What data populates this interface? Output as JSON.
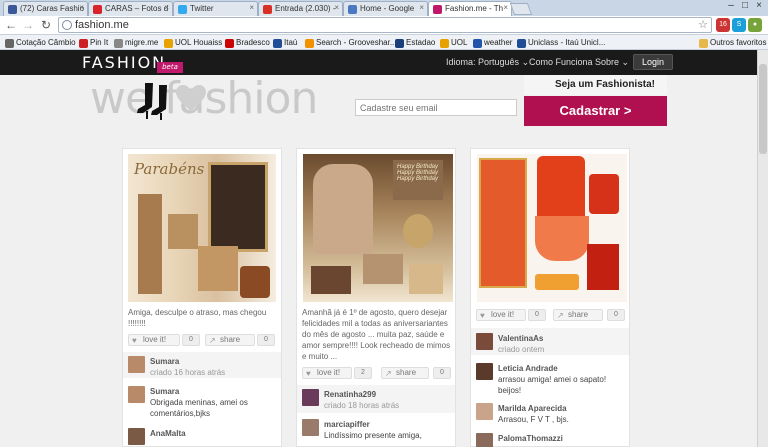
{
  "browser": {
    "tabs": [
      {
        "label": "(72) Caras Fashio",
        "color": "#3b5998"
      },
      {
        "label": "CARAS – Fotos d",
        "color": "#d8232a"
      },
      {
        "label": "Twitter",
        "color": "#33aaee"
      },
      {
        "label": "Entrada (2.030) -",
        "color": "#d93025"
      },
      {
        "label": "Home - Google",
        "color": "#4a78c2"
      },
      {
        "label": "Fashion.me - Th",
        "color": "#c0186a"
      }
    ],
    "url": "fashion.me",
    "bookmarks": [
      {
        "label": "Cotação Câmbio",
        "color": "#666"
      },
      {
        "label": "Pin It",
        "color": "#cc2127"
      },
      {
        "label": "migre.me",
        "color": "#888"
      },
      {
        "label": "UOL Houaiss",
        "color": "#e8a200"
      },
      {
        "label": "Bradesco",
        "color": "#cc0000"
      },
      {
        "label": "Itaú",
        "color": "#1f4e96"
      },
      {
        "label": "Search - Grooveshar...",
        "color": "#f39200"
      },
      {
        "label": "Estadao",
        "color": "#1a3e7a"
      },
      {
        "label": "UOL",
        "color": "#e8a200"
      },
      {
        "label": "weather",
        "color": "#2255aa"
      },
      {
        "label": "Uniclass - Itaú Unicl...",
        "color": "#1f4e96"
      },
      {
        "label": "Outros favoritos",
        "color": "#e6b84a"
      }
    ]
  },
  "site": {
    "logo": "FASHION",
    "beta": "beta",
    "nav": {
      "idioma": "Idioma: Português",
      "como": "Como Funciona",
      "sobre": "Sobre",
      "login": "Login"
    },
    "hero": {
      "text": "we fashion",
      "placeholder": "Cadastre seu email",
      "promo": "Seja um Fashionista!",
      "cta": "Cadastrar >"
    },
    "actions": {
      "love": "love it!",
      "share": "share"
    },
    "cards": [
      {
        "caption": "Amiga, desculpe o atraso, mas chegou !!!!!!!!",
        "love_count": "0",
        "share_count": "0",
        "comments": [
          {
            "user": "Sumara",
            "text": "criado 16 horas atrás"
          },
          {
            "user": "Sumara",
            "text": "Obrigada meninas, amei os comentários,bjks"
          },
          {
            "user": "AnaMalta",
            "text": ""
          }
        ]
      },
      {
        "caption": "Amanhã já é 1º de agosto, quero desejar felicidades mil a todas as aniversariantes do mês de agosto ... muita paz, saúde e amor sempre!!!! Look recheado de mimos e muito ...",
        "love_count": "2",
        "share_count": "0",
        "comments": [
          {
            "user": "Renatinha299",
            "text": "criado 18 horas atrás"
          },
          {
            "user": "marciapiffer",
            "text": "Lindíssimo presente amiga,"
          }
        ]
      },
      {
        "caption": "",
        "love_count": "0",
        "share_count": "0",
        "comments": [
          {
            "user": "ValentinaAs",
            "text": "criado ontem"
          },
          {
            "user": "Leticia Andrade",
            "text": "arrasou amiga! amei o sapato! beijos!"
          },
          {
            "user": "Marilda Aparecida",
            "text": "Arrasou, F V T , bjs."
          },
          {
            "user": "PalomaThomazzi",
            "text": ""
          }
        ]
      }
    ]
  }
}
